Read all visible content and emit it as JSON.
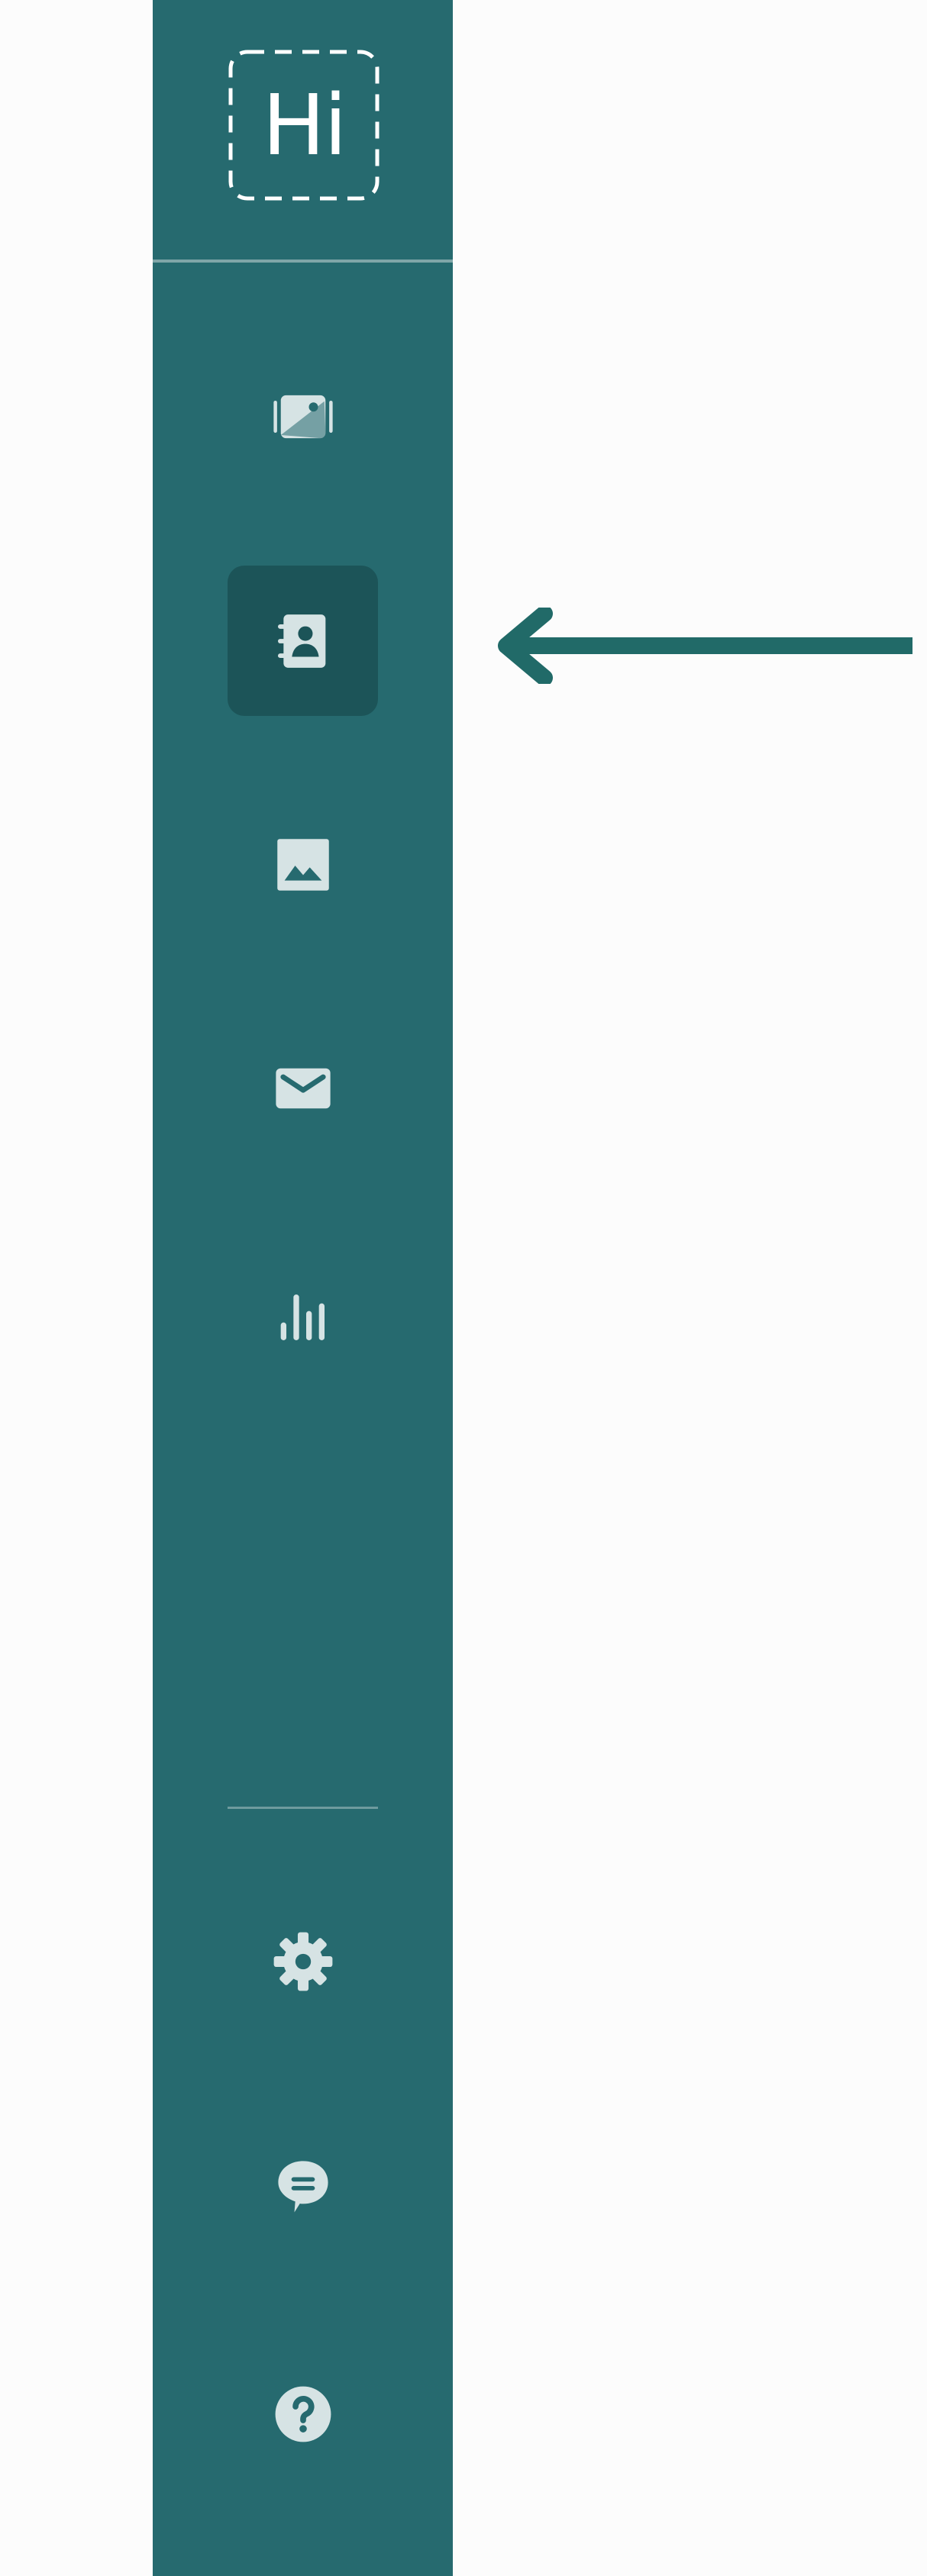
{
  "app": {
    "logo_text": "Hi"
  },
  "colors": {
    "sidebar_background": "#266a6f",
    "active_item_background": "#1c5458",
    "icon_color": "#d6e3e4",
    "arrow_color": "#216a68",
    "page_background": "#fcfcfc"
  },
  "sidebar": {
    "items": [
      {
        "id": "media",
        "icon": "photo-library-icon",
        "active": false
      },
      {
        "id": "contacts",
        "icon": "contact-book-icon",
        "active": true
      },
      {
        "id": "images",
        "icon": "image-icon",
        "active": false
      },
      {
        "id": "email",
        "icon": "envelope-icon",
        "active": false
      },
      {
        "id": "analytics",
        "icon": "bar-chart-icon",
        "active": false
      }
    ],
    "bottom_items": [
      {
        "id": "settings",
        "icon": "gear-icon"
      },
      {
        "id": "chat",
        "icon": "chat-bubble-icon"
      },
      {
        "id": "help",
        "icon": "help-icon"
      }
    ]
  },
  "annotation": {
    "icon": "arrow-left-icon",
    "points_to": "contacts"
  }
}
